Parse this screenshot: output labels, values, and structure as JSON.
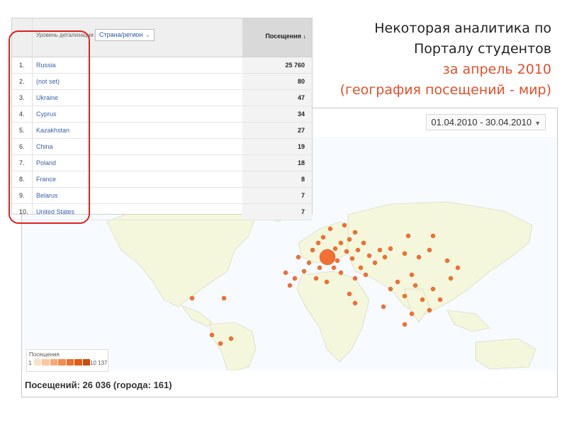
{
  "title": {
    "line1": "Некоторая аналитика по",
    "line2": "Порталу студентов",
    "line3": "за апрель 2010",
    "line4": "(география посещений - мир)"
  },
  "table": {
    "dimension_label": "Уровень детализации:",
    "dimension_value": "Страна/регион",
    "metric_header": "Посещения ↓",
    "rows": [
      {
        "n": "1.",
        "name": "Russia",
        "value": "25 760"
      },
      {
        "n": "2.",
        "name": "(not set)",
        "value": "80"
      },
      {
        "n": "3.",
        "name": "Ukraine",
        "value": "47"
      },
      {
        "n": "4.",
        "name": "Cyprus",
        "value": "34"
      },
      {
        "n": "5.",
        "name": "Kazakhstan",
        "value": "27"
      },
      {
        "n": "6.",
        "name": "China",
        "value": "19"
      },
      {
        "n": "7.",
        "name": "Poland",
        "value": "18"
      },
      {
        "n": "8.",
        "name": "France",
        "value": "8"
      },
      {
        "n": "9.",
        "name": "Belarus",
        "value": "7"
      },
      {
        "n": "10.",
        "name": "United States",
        "value": "7"
      }
    ]
  },
  "map": {
    "date_range": "01.04.2010 - 30.04.2010",
    "legend_title": "Посещения",
    "legend_min": "1",
    "legend_max": "10 137",
    "summary": "Посещений: 26 036 (города: 161)"
  },
  "colors": {
    "accent": "#e2502a",
    "dot": "#f06a2a",
    "land": "#f5f7dd",
    "water": "#f7fbff",
    "highlight_box": "#dd2222",
    "legend_scale": [
      "#fde0c8",
      "#fbc79e",
      "#f9a874",
      "#f48b4f",
      "#ee6f2c",
      "#e25a18",
      "#cc4a0c"
    ]
  }
}
